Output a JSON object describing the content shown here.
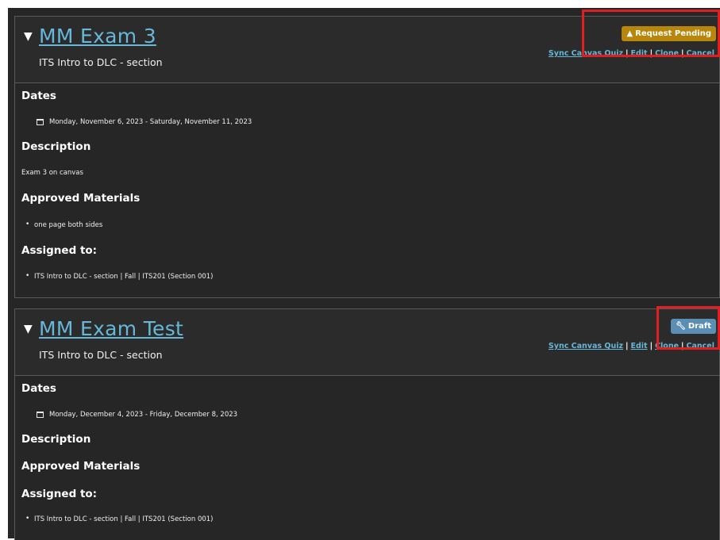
{
  "exams": [
    {
      "title": "MM Exam 3",
      "caret": "▼",
      "subtitle": "ITS Intro to DLC - section",
      "status_badge": "Request Pending",
      "status_icon": "warning-icon",
      "actions": {
        "sync": "Sync Canvas Quiz",
        "edit": "Edit",
        "clone": "Clone",
        "cancel": "Cancel"
      },
      "dates_heading": "Dates",
      "date_range": "Monday, November 6, 2023 - Saturday, November 11, 2023",
      "description_heading": "Description",
      "description": "Exam 3 on canvas",
      "materials_heading": "Approved Materials",
      "materials": [
        "one page both sides"
      ],
      "assigned_heading": "Assigned to:",
      "assigned": [
        "ITS Intro to DLC - section | Fall | ITS201 (Section 001)"
      ]
    },
    {
      "title": "MM Exam Test",
      "caret": "▼",
      "subtitle": "ITS Intro to DLC - section",
      "status_badge": "Draft",
      "status_icon": "wrench-icon",
      "actions": {
        "sync": "Sync Canvas Quiz",
        "edit": "Edit",
        "clone": "Clone",
        "cancel": "Cancel"
      },
      "dates_heading": "Dates",
      "date_range": "Monday, December 4, 2023 - Friday, December 8, 2023",
      "description_heading": "Description",
      "materials_heading": "Approved Materials",
      "assigned_heading": "Assigned to:",
      "assigned": [
        "ITS Intro to DLC - section | Fall | ITS201 (Section 001)"
      ]
    }
  ],
  "colors": {
    "background": "#262626",
    "link": "#66b7d8",
    "pending_badge": "#b8860b",
    "draft_badge": "#5a8fb3",
    "highlight": "#e02020"
  }
}
